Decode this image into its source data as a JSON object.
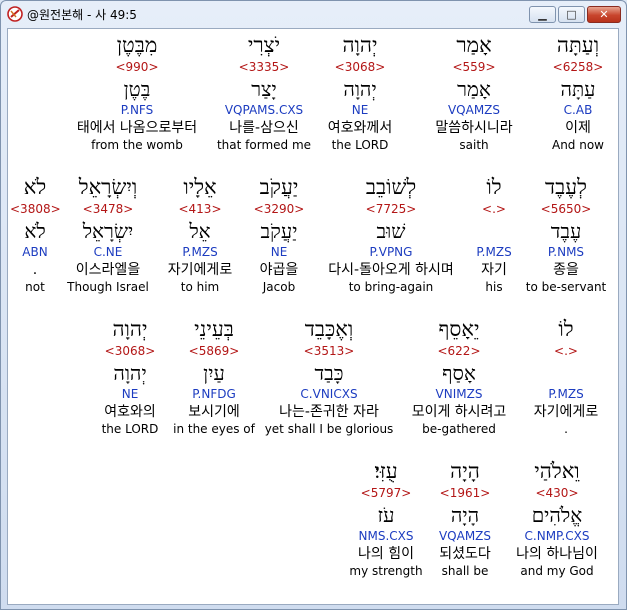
{
  "window": {
    "title": "@원전본해 - 사 49:5",
    "minimize_glyph": "▁",
    "maximize_glyph": "□",
    "close_glyph": "✕"
  },
  "rows": [
    [
      {
        "heb": "וְעַתָּה",
        "strong": "<6258>",
        "lemma": "עַתָּה",
        "code": "C.AB",
        "kor": "이제",
        "eng": "And now"
      },
      {
        "heb": "אָמַר",
        "strong": "<559>",
        "lemma": "אָמַר",
        "code": "VQAMZS",
        "kor": "말씀하시니라",
        "eng": "saith"
      },
      {
        "heb": "יְהוָה",
        "strong": "<3068>",
        "lemma": "יְהוָה",
        "code": "NE",
        "kor": "여호와께서",
        "eng": "the LORD"
      },
      {
        "heb": "יֹצְרִי",
        "strong": "<3335>",
        "lemma": "יָצַר",
        "code": "VQPAMS.CXS",
        "kor": "나를-삼으신",
        "eng": "that formed me"
      },
      {
        "heb": "מִבֶּטֶן",
        "strong": "<990>",
        "lemma": "בֶּטֶן",
        "code": "P.NFS",
        "kor": "태에서 나옴으로부터",
        "eng": "from the womb"
      }
    ],
    [
      {
        "heb": "לְעֶבֶד",
        "strong": "<5650>",
        "lemma": "עֶבֶד",
        "code": "P.NMS",
        "kor": "종을",
        "eng": "to be-servant"
      },
      {
        "heb": "לוֹ",
        "strong": "<.>",
        "lemma": "",
        "code": "P.MZS",
        "kor": "자기",
        "eng": "his"
      },
      {
        "heb": "לְשׁוֹבֵב",
        "strong": "<7725>",
        "lemma": "שׁוּב",
        "code": "P.VPNG",
        "kor": "다시-돌아오게 하시며",
        "eng": "to bring-again"
      },
      {
        "heb": "יַעֲקֹב",
        "strong": "<3290>",
        "lemma": "יַעֲקֹב",
        "code": "NE",
        "kor": "야곱을",
        "eng": "Jacob"
      },
      {
        "heb": "אֵלָיו",
        "strong": "<413>",
        "lemma": "אֵל",
        "code": "P.MZS",
        "kor": "자기에게로",
        "eng": "to him"
      },
      {
        "heb": "וְיִשְׂרָאֵל",
        "strong": "<3478>",
        "lemma": "יִשְׂרָאֵל",
        "code": "C.NE",
        "kor": "이스라엘을",
        "eng": "Though Israel"
      },
      {
        "heb": "לֹא",
        "strong": "<3808>",
        "lemma": "לֹא",
        "code": "ABN",
        "kor": ".",
        "eng": "not"
      }
    ],
    [
      {
        "heb": "לוֹ",
        "strong": "<.>",
        "lemma": "",
        "code": "P.MZS",
        "kor": "자기에게로",
        "eng": "."
      },
      {
        "heb": "יֵאָסֵף",
        "strong": "<622>",
        "lemma": "אָסַף",
        "code": "VNIMZS",
        "kor": "모이게 하시려고",
        "eng": "be-gathered"
      },
      {
        "heb": "וְאֶכָּבֵד",
        "strong": "<3513>",
        "lemma": "כָּבַד",
        "code": "C.VNICXS",
        "kor": "나는-존귀한 자라",
        "eng": "yet shall I be glorious"
      },
      {
        "heb": "בְּעֵינֵי",
        "strong": "<5869>",
        "lemma": "עַיִן",
        "code": "P.NFDG",
        "kor": "보시기에",
        "eng": "in the eyes of"
      },
      {
        "heb": "יְהוָה",
        "strong": "<3068>",
        "lemma": "יְהוָה",
        "code": "NE",
        "kor": "여호와의",
        "eng": "the LORD"
      }
    ],
    [
      {
        "heb": "וֵאלֹהַי",
        "strong": "<430>",
        "lemma": "אֱלֹהִים",
        "code": "C.NMP.CXS",
        "kor": "나의 하나님이",
        "eng": "and my God"
      },
      {
        "heb": "הָיָה",
        "strong": "<1961>",
        "lemma": "הָיָה",
        "code": "VQAMZS",
        "kor": "되셨도다",
        "eng": "shall be"
      },
      {
        "heb": "עֻזִּי׃",
        "strong": "<5797>",
        "lemma": "עֹז",
        "code": "NMS.CXS",
        "kor": "나의 힘이",
        "eng": "my strength"
      }
    ]
  ]
}
